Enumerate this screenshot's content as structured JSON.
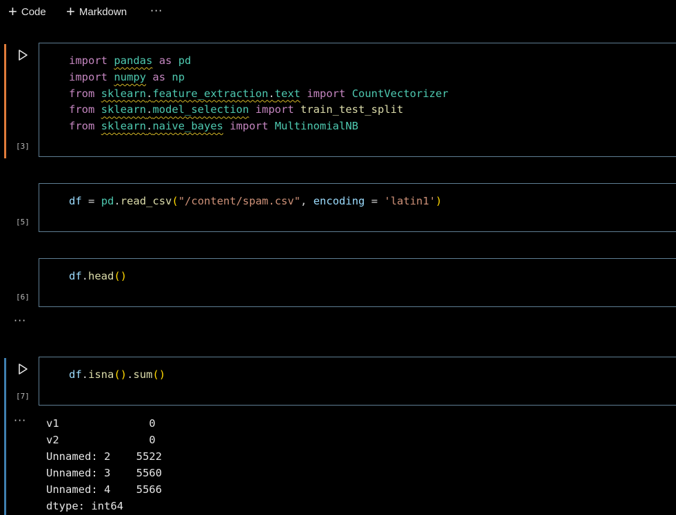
{
  "toolbar": {
    "code_label": "Code",
    "markdown_label": "Markdown",
    "more": "···"
  },
  "cells": [
    {
      "exec": "[3]",
      "lines": [
        [
          "import",
          "pandas",
          "as",
          "pd"
        ],
        [
          "import",
          "numpy",
          "as",
          "np"
        ],
        [
          "from",
          "sklearn",
          "feature_extraction",
          "text",
          "import",
          "CountVectorizer"
        ],
        [
          "from",
          "sklearn",
          "model_selection",
          "import",
          "train_test_split"
        ],
        [
          "from",
          "sklearn",
          "naive_bayes",
          "import",
          "MultinomialNB"
        ]
      ]
    },
    {
      "exec": "[5]",
      "code": {
        "var": "df",
        "mod": "pd",
        "fn": "read_csv",
        "path": "\"/content/spam.csv\"",
        "kwarg": "encoding",
        "kwval": "'latin1'"
      }
    },
    {
      "exec": "[6]",
      "code": {
        "var": "df",
        "fn": "head"
      },
      "output_collapsed": "···"
    },
    {
      "exec": "[7]",
      "code": {
        "var": "df",
        "fn1": "isna",
        "fn2": "sum"
      },
      "output_more": "···",
      "output": "v1              0\nv2              0\nUnnamed: 2    5522\nUnnamed: 3    5560\nUnnamed: 4    5566\ndtype: int64"
    }
  ],
  "colors": {
    "selected_bar": "#e07b3a",
    "focus_bar": "#3f7fb0",
    "editor_border": "#5f7f95"
  }
}
